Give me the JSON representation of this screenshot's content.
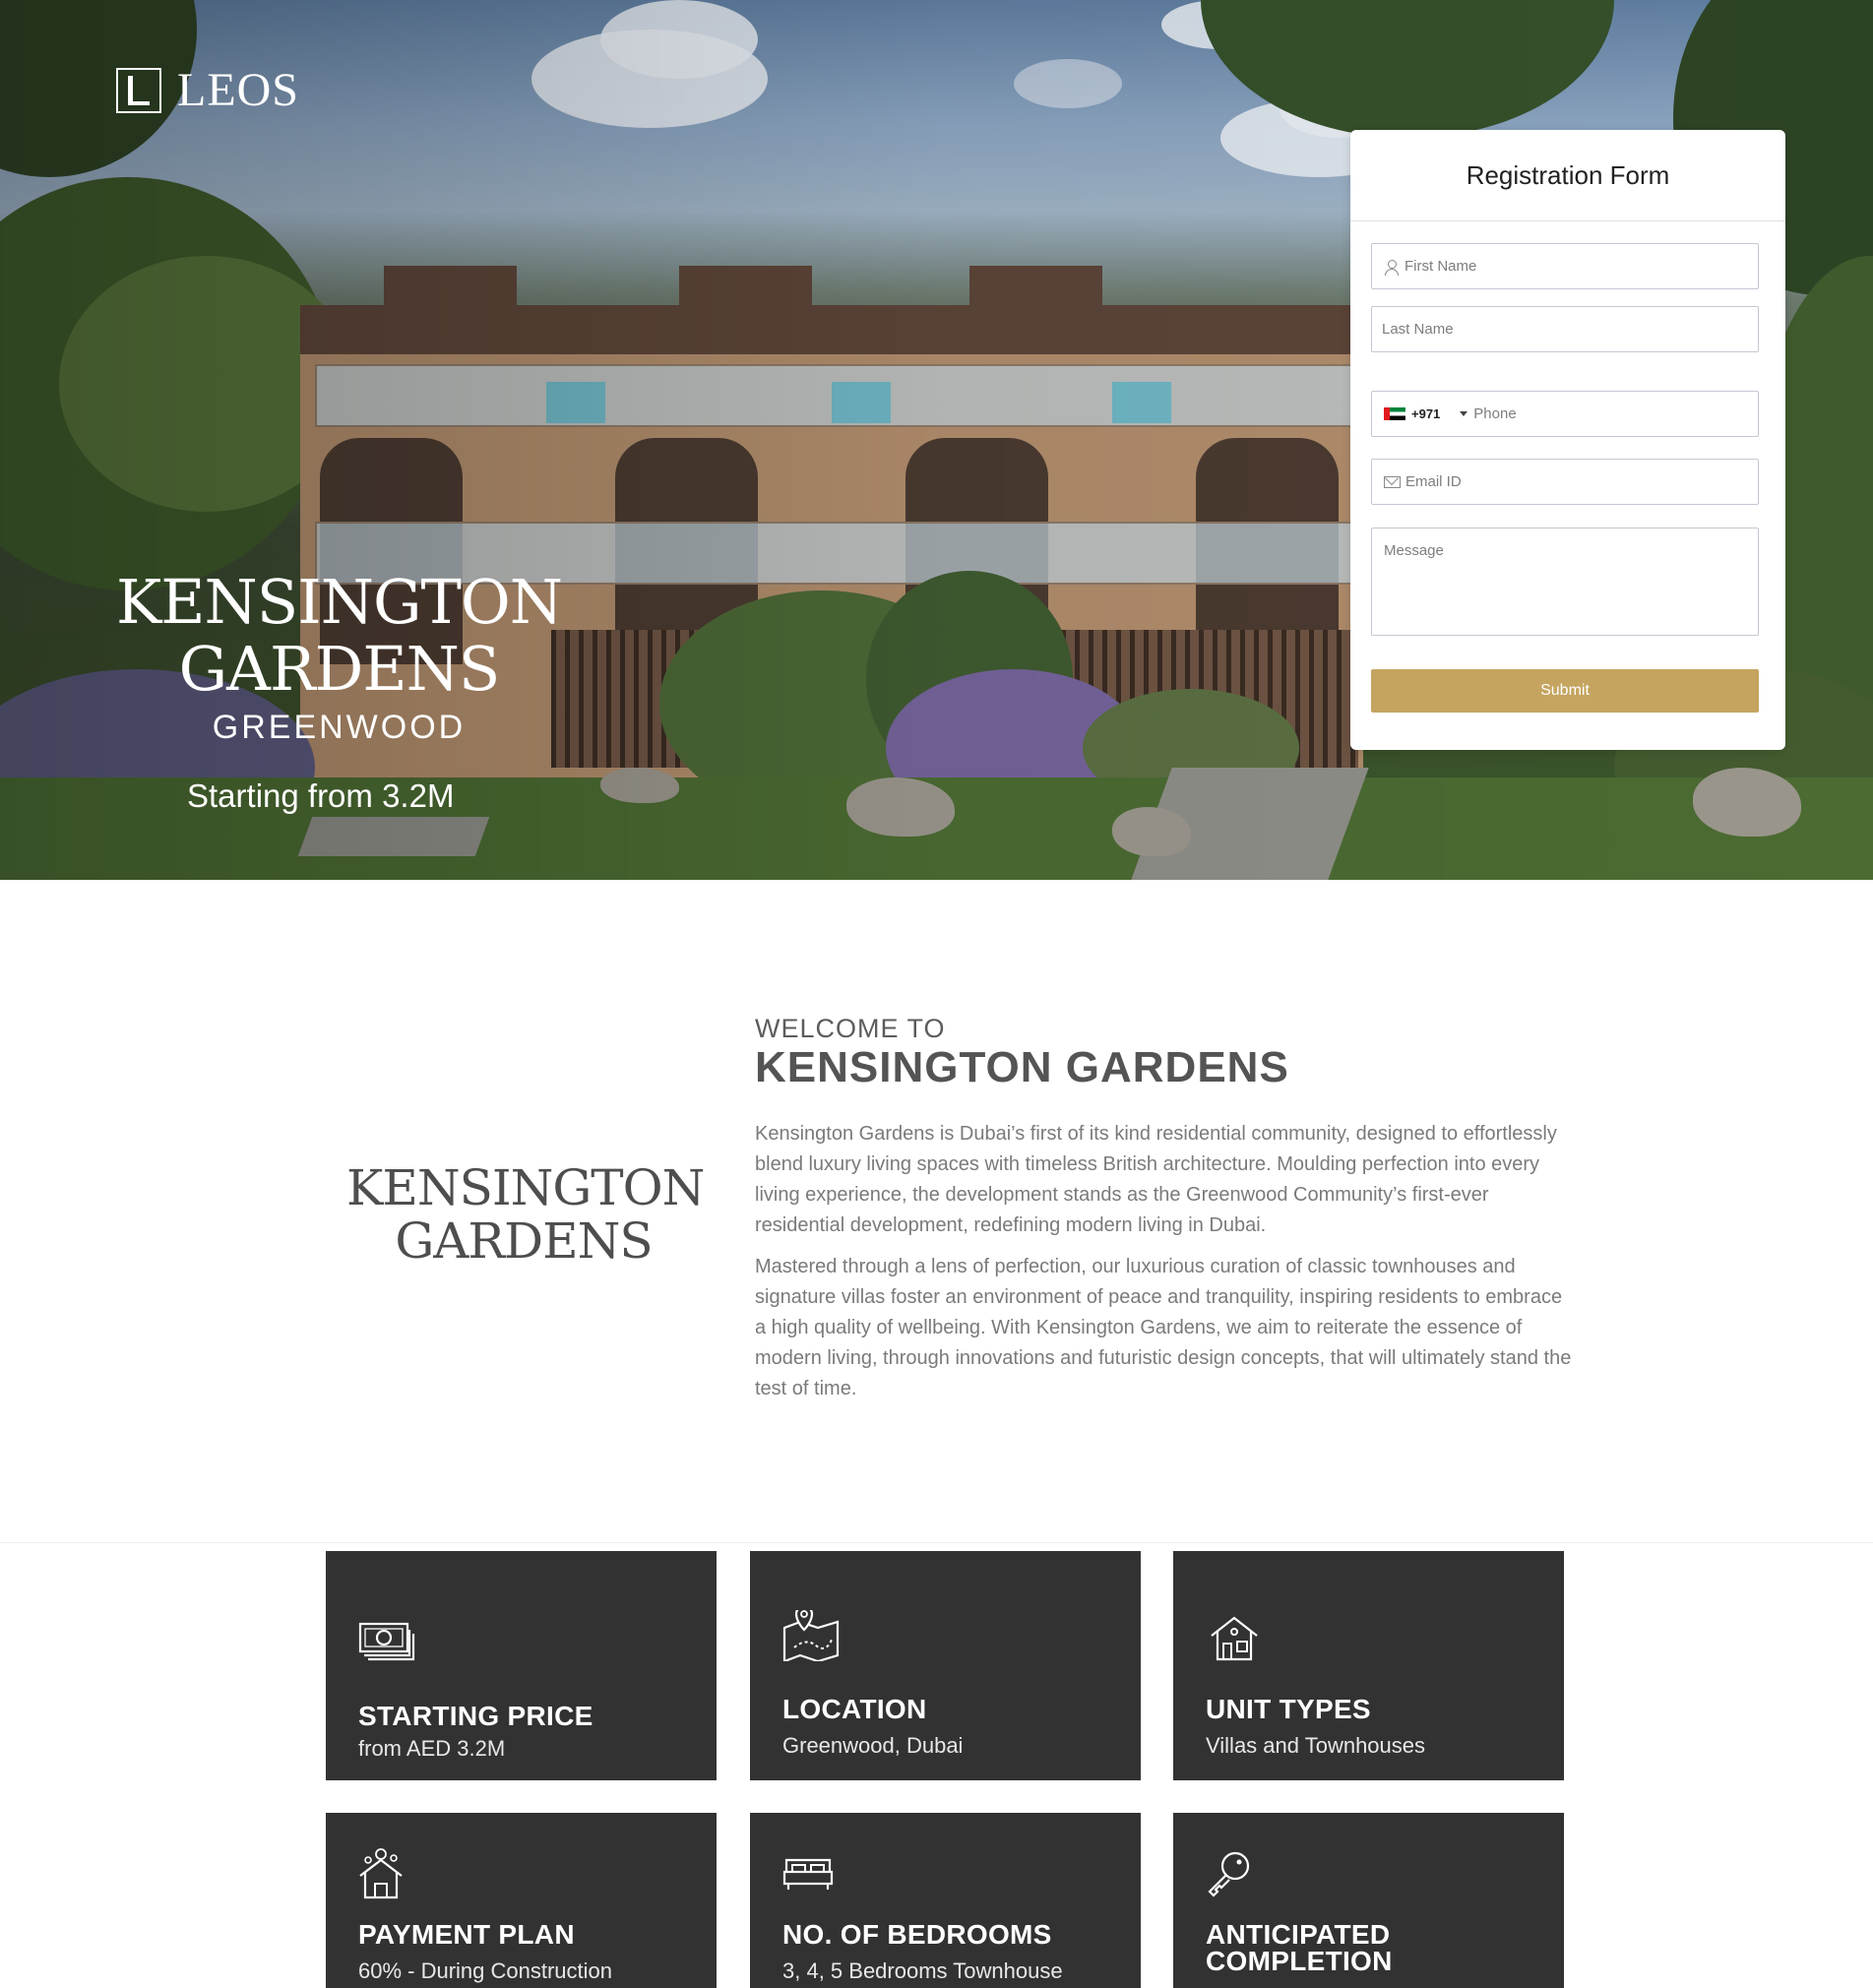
{
  "brand": {
    "logo_text": "LEOS"
  },
  "hero": {
    "title_line1": "KENSINGTON",
    "title_line2": "GARDENS",
    "subtitle": "GREENWOOD",
    "price": "Starting from 3.2M"
  },
  "form": {
    "title": "Registration Form",
    "first_name_placeholder": "First Name",
    "last_name_placeholder": "Last Name",
    "country_code": "+971",
    "phone_placeholder": "Phone",
    "email_placeholder": "Email ID",
    "message_placeholder": "Message",
    "submit_label": "Submit"
  },
  "welcome": {
    "logo_line1": "KENSINGTON",
    "logo_line2": "GARDENS",
    "kicker": "WELCOME TO",
    "title": "KENSINGTON GARDENS",
    "paragraph1": "Kensington Gardens is Dubai’s first of its kind residential community, designed to effortlessly blend luxury living spaces with timeless British architecture. Moulding perfection into every living experience, the development stands as the Greenwood Community’s first-ever residential development, redefining modern living in Dubai.",
    "paragraph2": "Mastered through a lens of perfection, our luxurious curation of classic townhouses and signature villas foster an environment of peace and tranquility, inspiring residents to embrace a high quality of wellbeing. With Kensington Gardens, we aim to reiterate the essence of modern living, through innovations and futuristic design concepts, that will ultimately stand the test of time."
  },
  "features": [
    {
      "title": "STARTING PRICE",
      "value": "from AED 3.2M",
      "icon": "money-icon"
    },
    {
      "title": "LOCATION",
      "value": "Greenwood, Dubai",
      "icon": "map-icon"
    },
    {
      "title": "UNIT TYPES",
      "value": "Villas and Townhouses",
      "icon": "house-icon"
    },
    {
      "title": "PAYMENT PLAN",
      "value": "60% - During Construction",
      "icon": "home-payment-icon"
    },
    {
      "title": "NO. OF BEDROOMS",
      "value": "3, 4, 5 Bedrooms Townhouse",
      "icon": "bed-icon"
    },
    {
      "title": "ANTICIPATED",
      "title2": "COMPLETION",
      "value": "",
      "icon": "key-icon"
    }
  ],
  "colors": {
    "accent": "#c5a45f",
    "card_bg": "#323232",
    "heading": "#545454"
  }
}
